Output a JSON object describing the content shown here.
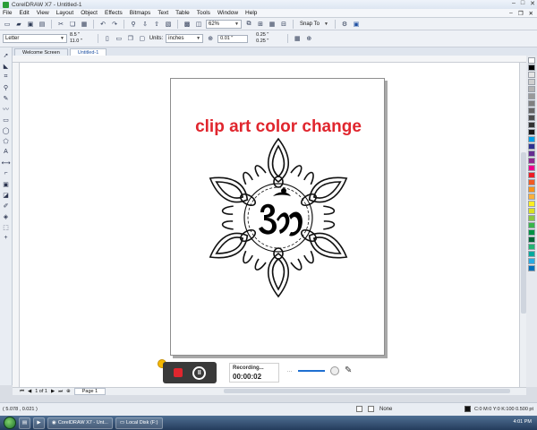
{
  "window": {
    "title": "CorelDRAW X7 - Untitled-1"
  },
  "menu": [
    "File",
    "Edit",
    "View",
    "Layout",
    "Object",
    "Effects",
    "Bitmaps",
    "Text",
    "Table",
    "Tools",
    "Window",
    "Help"
  ],
  "toolbar": {
    "zoom": "62%",
    "snap_to": "Snap To"
  },
  "property_bar": {
    "paper_type": "Letter",
    "width": "8.5 \"",
    "height": "11.0 \"",
    "units_label": "Units:",
    "units": "inches",
    "nudge": "0.01 \"",
    "dup_x": "0.25 \"",
    "dup_y": "0.25 \""
  },
  "doc_tabs": [
    "Welcome Screen",
    "Untitled-1"
  ],
  "canvas": {
    "headline": "clip art color change"
  },
  "recording": {
    "label": "Recording...",
    "time": "00:00:02"
  },
  "page_nav": {
    "counter": "1 of 1",
    "page_tab": "Page 1"
  },
  "status": {
    "coords": "( 5.078 , 0.021 )",
    "fill": "None",
    "outline": "C:0 M:0 Y:0 K:100  0.500 pt"
  },
  "taskbar": {
    "items": [
      "CorelDRAW X7 - Unt...",
      "Local Disk (F:)"
    ],
    "clock": "4:01 PM"
  },
  "palette_colors": [
    "#ffffff",
    "#000000",
    "#e6e6e6",
    "#cfcfcf",
    "#b3b3b3",
    "#999999",
    "#808080",
    "#666666",
    "#4d4d4d",
    "#333333",
    "#1a1a1a",
    "#00a0e9",
    "#2e3192",
    "#662d91",
    "#92278f",
    "#ec008c",
    "#ed1c24",
    "#f15a24",
    "#f7931e",
    "#fbb03b",
    "#fcee21",
    "#d9e021",
    "#8cc63f",
    "#39b54a",
    "#009245",
    "#006837",
    "#22b573",
    "#00a99d",
    "#29abe2",
    "#0071bc"
  ]
}
